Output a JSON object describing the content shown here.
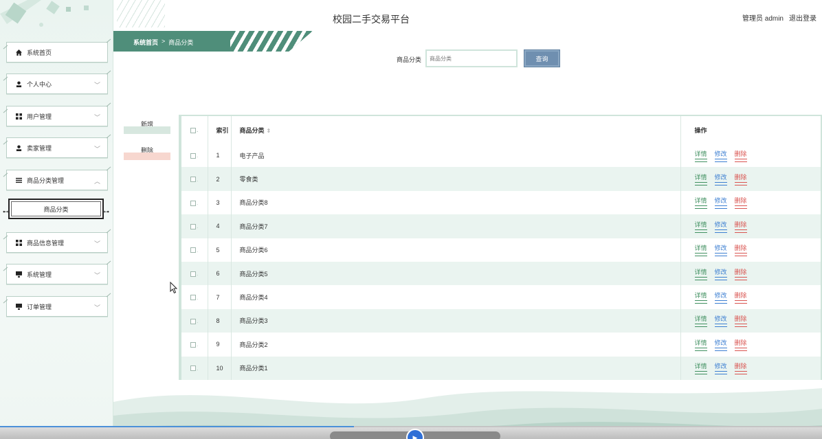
{
  "header": {
    "title": "校园二手交易平台",
    "user_label": "管理员 admin",
    "logout_label": "退出登录"
  },
  "breadcrumb": {
    "home": "系统首页",
    "separator": ">",
    "current": "商品分类"
  },
  "sidebar": {
    "items": [
      {
        "label": "系统首页",
        "icon": "home-icon",
        "has_chevron": false
      },
      {
        "label": "个人中心",
        "icon": "person-icon",
        "has_chevron": true
      },
      {
        "label": "用户管理",
        "icon": "grid-icon",
        "has_chevron": true
      },
      {
        "label": "卖家管理",
        "icon": "person-icon",
        "has_chevron": true
      },
      {
        "label": "商品分类管理",
        "icon": "menu-icon",
        "has_chevron": true,
        "expanded": true
      },
      {
        "label": "商品信息管理",
        "icon": "grid-icon",
        "has_chevron": true
      },
      {
        "label": "系统管理",
        "icon": "monitor-icon",
        "has_chevron": true
      },
      {
        "label": "订单管理",
        "icon": "monitor-icon",
        "has_chevron": true
      }
    ],
    "sub_item": "商品分类"
  },
  "search": {
    "label": "商品分类",
    "placeholder": "商品分类",
    "button": "查询"
  },
  "actions": {
    "add": "新增",
    "delete": "删除"
  },
  "table": {
    "headers": {
      "index": "索引",
      "name": "商品分类",
      "ops": "操作"
    },
    "ops_labels": {
      "detail": "详情",
      "edit": "修改",
      "delete": "删除"
    },
    "rows": [
      {
        "index": "1",
        "name": "电子产品"
      },
      {
        "index": "2",
        "name": "零食类"
      },
      {
        "index": "3",
        "name": "商品分类8"
      },
      {
        "index": "4",
        "name": "商品分类7"
      },
      {
        "index": "5",
        "name": "商品分类6"
      },
      {
        "index": "6",
        "name": "商品分类5"
      },
      {
        "index": "7",
        "name": "商品分类4"
      },
      {
        "index": "8",
        "name": "商品分类3"
      },
      {
        "index": "9",
        "name": "商品分类2"
      },
      {
        "index": "10",
        "name": "商品分类1"
      }
    ]
  },
  "colors": {
    "brand": "#4f8e7a",
    "row_alt": "#eaf4f0",
    "detail": "#3f8f5f",
    "edit": "#3b7ed1",
    "delete": "#d9534f",
    "search_button": "#6f8fb0"
  },
  "video": {
    "progress": 0.43
  }
}
